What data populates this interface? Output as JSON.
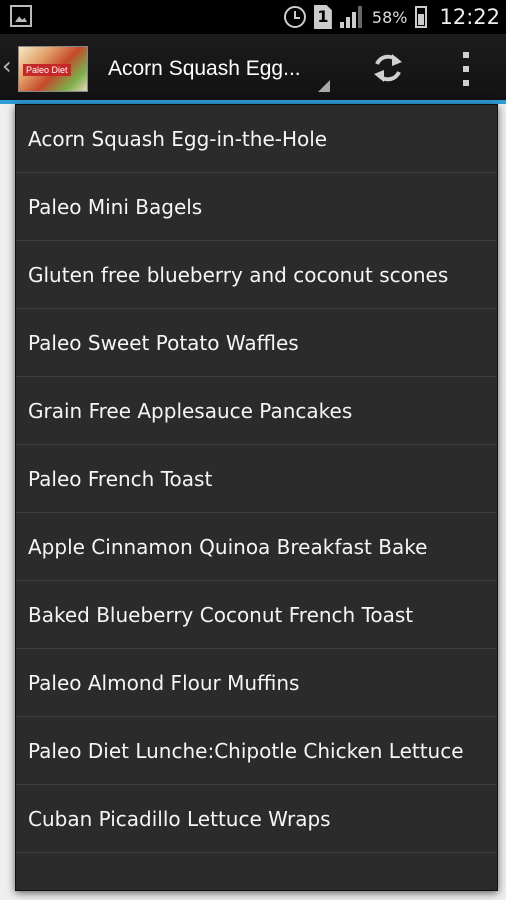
{
  "status_bar": {
    "battery_percent": "58%",
    "time": "12:22",
    "sim_label": "1"
  },
  "action_bar": {
    "logo_text": "Paleo Diet",
    "selected_title": "Acorn Squash Egg..."
  },
  "dropdown": {
    "items": [
      "Acorn Squash Egg-in-the-Hole",
      "Paleo Mini Bagels",
      "Gluten free blueberry and coconut scones",
      "Paleo Sweet Potato Waffles",
      "Grain Free Applesauce Pancakes",
      "Paleo French Toast",
      "Apple Cinnamon Quinoa Breakfast Bake",
      "Baked Blueberry Coconut French Toast",
      "Paleo Almond Flour Muffins",
      "Paleo Diet Lunche:Chipotle Chicken Lettuce",
      "Cuban Picadillo Lettuce Wraps"
    ]
  },
  "colors": {
    "accent": "#2f9ed8",
    "menu_bg": "#2b2b2b",
    "action_bar_bg": "#1c1c1c"
  }
}
